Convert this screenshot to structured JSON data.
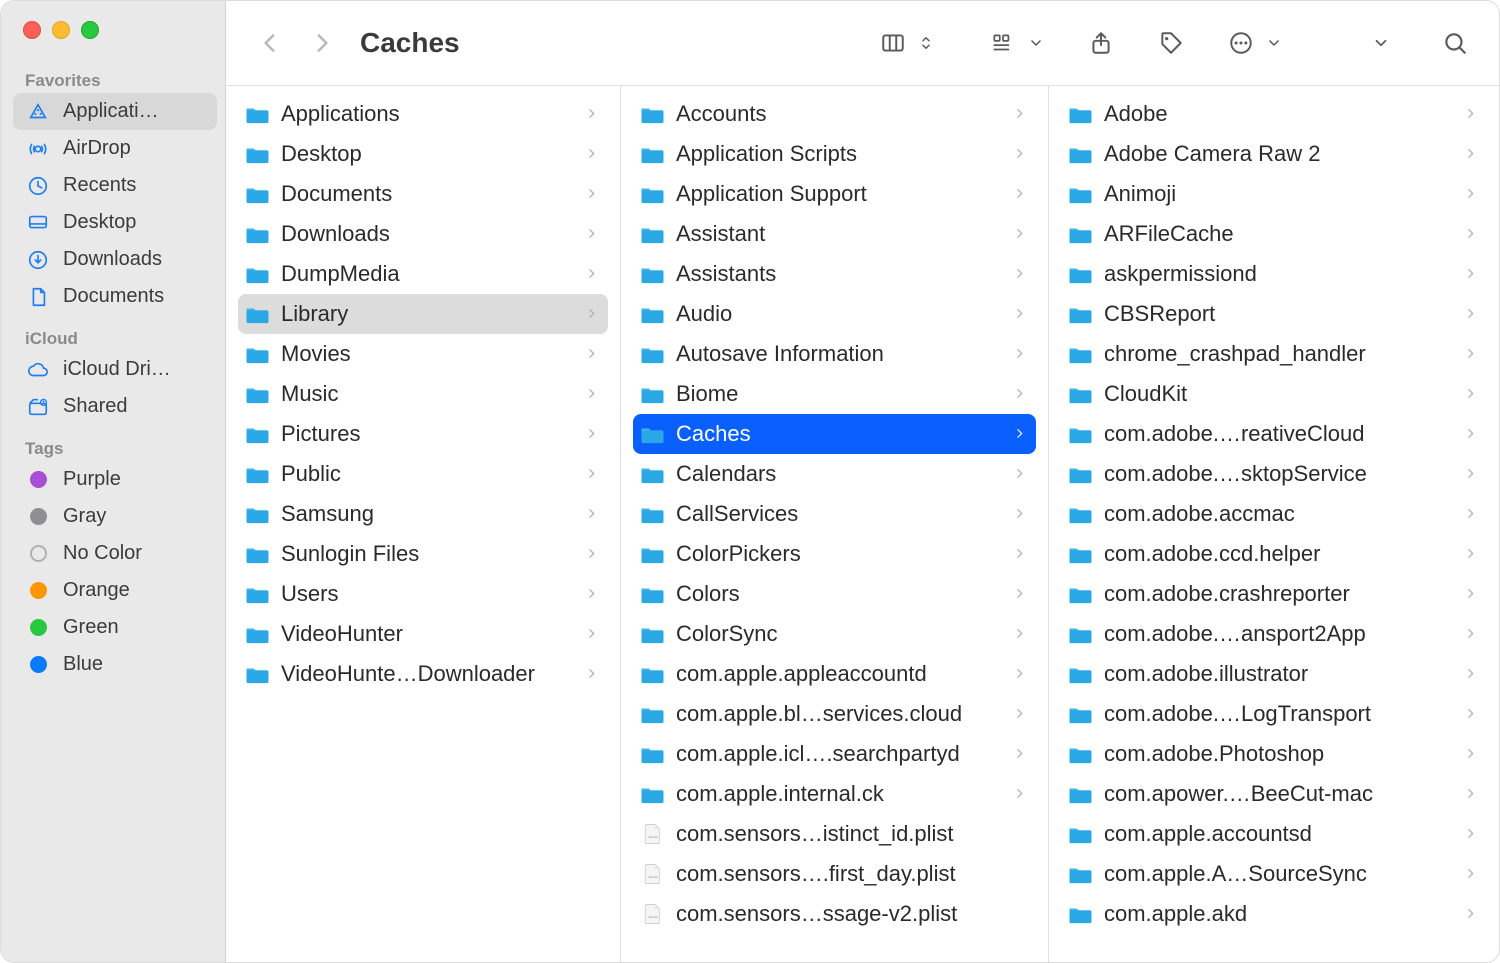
{
  "title": "Caches",
  "toolbar_icons": [
    "back",
    "forward",
    "view-columns",
    "sort-chevrons",
    "grid-opts",
    "dropdown-chevron",
    "share",
    "tag",
    "more",
    "dropdown-chevron-2",
    "single-chevron",
    "search"
  ],
  "sidebar": {
    "favorites_label": "Favorites",
    "icloud_label": "iCloud",
    "tags_label": "Tags",
    "favorites": [
      {
        "icon": "applications",
        "label": "Applicati…"
      },
      {
        "icon": "airdrop",
        "label": "AirDrop"
      },
      {
        "icon": "recents",
        "label": "Recents"
      },
      {
        "icon": "desktop",
        "label": "Desktop"
      },
      {
        "icon": "downloads",
        "label": "Downloads"
      },
      {
        "icon": "documents",
        "label": "Documents"
      }
    ],
    "icloud": [
      {
        "icon": "icloud",
        "label": "iCloud Dri…"
      },
      {
        "icon": "shared",
        "label": "Shared"
      }
    ],
    "tags": [
      {
        "color": "#a550d6",
        "label": "Purple"
      },
      {
        "color": "#8e8e93",
        "label": "Gray"
      },
      {
        "color": "",
        "label": "No Color"
      },
      {
        "color": "#ff9500",
        "label": "Orange"
      },
      {
        "color": "#28c840",
        "label": "Green"
      },
      {
        "color": "#0a7aff",
        "label": "Blue"
      }
    ]
  },
  "columns": [
    {
      "items": [
        {
          "t": "f",
          "n": "Applications"
        },
        {
          "t": "f",
          "n": "Desktop"
        },
        {
          "t": "f",
          "n": "Documents"
        },
        {
          "t": "f",
          "n": "Downloads"
        },
        {
          "t": "f",
          "n": "DumpMedia"
        },
        {
          "t": "f",
          "n": "Library",
          "sel": "gray"
        },
        {
          "t": "f",
          "n": "Movies"
        },
        {
          "t": "f",
          "n": "Music"
        },
        {
          "t": "f",
          "n": "Pictures"
        },
        {
          "t": "f",
          "n": "Public"
        },
        {
          "t": "f",
          "n": "Samsung"
        },
        {
          "t": "f",
          "n": "Sunlogin Files"
        },
        {
          "t": "f",
          "n": "Users"
        },
        {
          "t": "f",
          "n": "VideoHunter"
        },
        {
          "t": "f",
          "n": "VideoHunte…Downloader"
        }
      ]
    },
    {
      "items": [
        {
          "t": "f",
          "n": "Accounts"
        },
        {
          "t": "f",
          "n": "Application Scripts"
        },
        {
          "t": "f",
          "n": "Application Support"
        },
        {
          "t": "f",
          "n": "Assistant"
        },
        {
          "t": "f",
          "n": "Assistants"
        },
        {
          "t": "f",
          "n": "Audio"
        },
        {
          "t": "f",
          "n": "Autosave Information"
        },
        {
          "t": "f",
          "n": "Biome"
        },
        {
          "t": "f",
          "n": "Caches",
          "sel": "blue"
        },
        {
          "t": "f",
          "n": "Calendars"
        },
        {
          "t": "f",
          "n": "CallServices"
        },
        {
          "t": "f",
          "n": "ColorPickers"
        },
        {
          "t": "f",
          "n": "Colors"
        },
        {
          "t": "f",
          "n": "ColorSync"
        },
        {
          "t": "f",
          "n": "com.apple.appleaccountd"
        },
        {
          "t": "f",
          "n": "com.apple.bl…services.cloud"
        },
        {
          "t": "f",
          "n": "com.apple.icl….searchpartyd"
        },
        {
          "t": "f",
          "n": "com.apple.internal.ck"
        },
        {
          "t": "d",
          "n": "com.sensors…istinct_id.plist"
        },
        {
          "t": "d",
          "n": "com.sensors….first_day.plist"
        },
        {
          "t": "d",
          "n": "com.sensors…ssage-v2.plist"
        }
      ]
    },
    {
      "items": [
        {
          "t": "f",
          "n": "Adobe"
        },
        {
          "t": "f",
          "n": "Adobe Camera Raw 2"
        },
        {
          "t": "f",
          "n": "Animoji"
        },
        {
          "t": "f",
          "n": "ARFileCache"
        },
        {
          "t": "f",
          "n": "askpermissiond"
        },
        {
          "t": "f",
          "n": "CBSReport"
        },
        {
          "t": "f",
          "n": "chrome_crashpad_handler"
        },
        {
          "t": "f",
          "n": "CloudKit"
        },
        {
          "t": "f",
          "n": "com.adobe.…reativeCloud"
        },
        {
          "t": "f",
          "n": "com.adobe.…sktopService"
        },
        {
          "t": "f",
          "n": "com.adobe.accmac"
        },
        {
          "t": "f",
          "n": "com.adobe.ccd.helper"
        },
        {
          "t": "f",
          "n": "com.adobe.crashreporter"
        },
        {
          "t": "f",
          "n": "com.adobe.…ansport2App"
        },
        {
          "t": "f",
          "n": "com.adobe.illustrator"
        },
        {
          "t": "f",
          "n": "com.adobe.…LogTransport"
        },
        {
          "t": "f",
          "n": "com.adobe.Photoshop"
        },
        {
          "t": "f",
          "n": "com.apower.…BeeCut-mac"
        },
        {
          "t": "f",
          "n": "com.apple.accountsd"
        },
        {
          "t": "f",
          "n": "com.apple.A…SourceSync"
        },
        {
          "t": "f",
          "n": "com.apple.akd"
        }
      ]
    }
  ]
}
